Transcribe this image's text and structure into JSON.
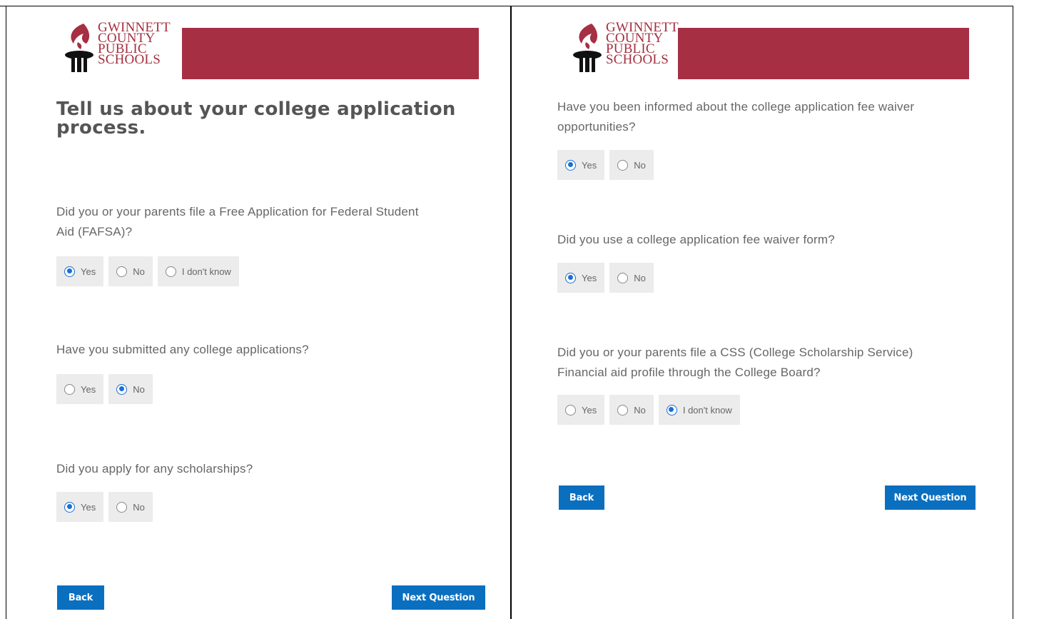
{
  "logo": {
    "line1": "GWINNETT",
    "line2": "COUNTY",
    "line3": "PUBLIC",
    "line4": "SCHOOLS",
    "icon": "torch-icon",
    "brand_color": "#a62f43"
  },
  "left": {
    "heading_line1": "Tell us about your college application",
    "heading_line2": "process.",
    "q1": {
      "line1": "Did you or your parents file a Free Application for Federal Student",
      "line2": "Aid (FAFSA)?",
      "options": [
        "Yes",
        "No",
        "I don't know"
      ],
      "selected": "Yes"
    },
    "q2": {
      "text": "Have you submitted any college applications?",
      "options": [
        "Yes",
        "No"
      ],
      "selected": "No"
    },
    "q3": {
      "text": "Did you apply for any scholarships?",
      "options": [
        "Yes",
        "No"
      ],
      "selected": "Yes"
    },
    "back_label": "Back",
    "next_label": "Next Question"
  },
  "right": {
    "q1": {
      "line1": "Have you been informed about the college application fee waiver",
      "line2": "opportunities?",
      "options": [
        "Yes",
        "No"
      ],
      "selected": "Yes"
    },
    "q2": {
      "text": "Did you use a college application fee waiver form?",
      "options": [
        "Yes",
        "No"
      ],
      "selected": "Yes"
    },
    "q3": {
      "line1": "Did you or your parents file a CSS (College Scholarship Service)",
      "line2": "Financial aid profile through the College Board?",
      "options": [
        "Yes",
        "No",
        "I don't know"
      ],
      "selected": "I don't know"
    },
    "back_label": "Back",
    "next_label": "Next Question"
  },
  "colors": {
    "accent": "#0b6fc0",
    "radio_selected": "#1a6fd8",
    "option_bg": "#ececec"
  }
}
